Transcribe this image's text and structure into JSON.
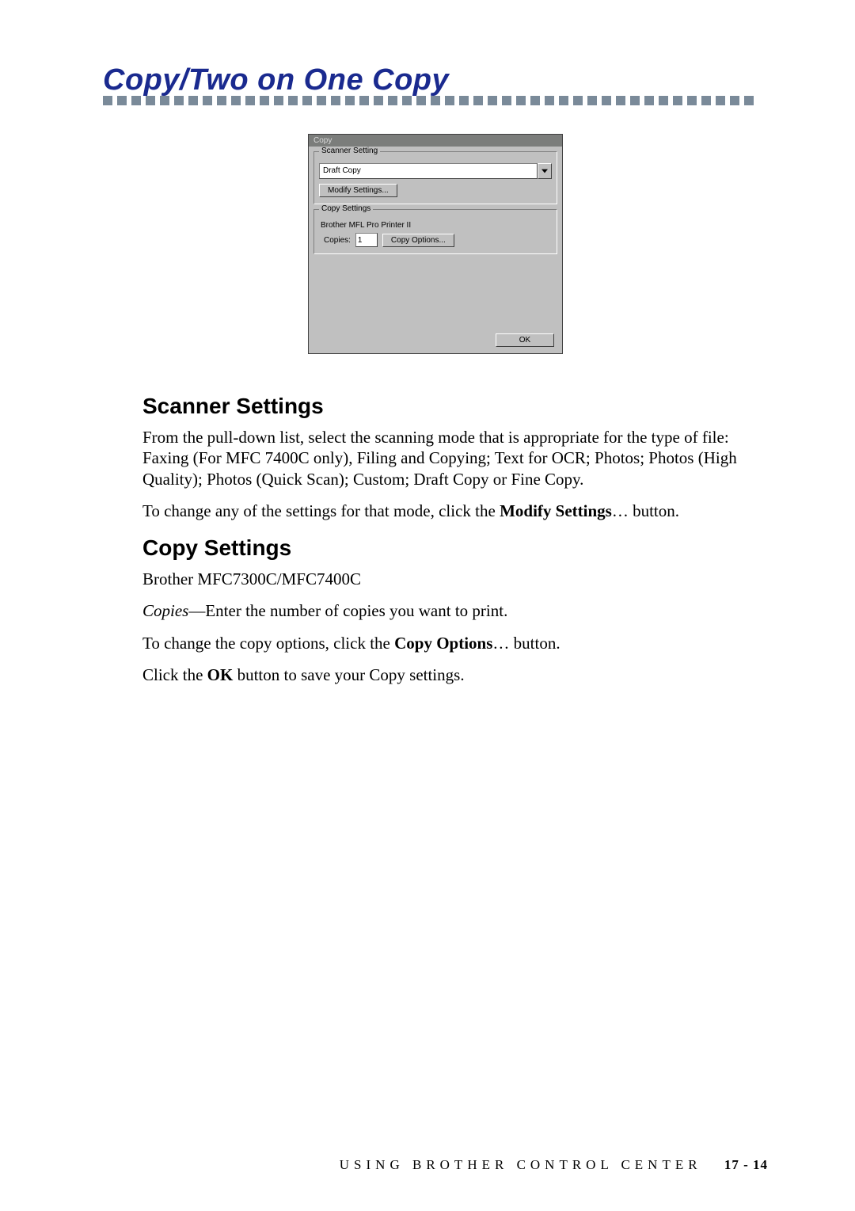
{
  "title": "Copy/Two on One Copy",
  "dialog": {
    "window_title": "Copy",
    "scanner_group": {
      "legend": "Scanner Setting",
      "selected": "Draft Copy",
      "modify_btn": "Modify Settings..."
    },
    "copy_group": {
      "legend": "Copy Settings",
      "printer": "Brother MFL Pro Printer II",
      "copies_label": "Copies:",
      "copies_value": "1",
      "copy_options_btn": "Copy Options..."
    },
    "ok_btn": "OK"
  },
  "sections": {
    "scanner": {
      "heading": "Scanner Settings",
      "p1": "From the pull-down list, select the scanning mode that is appropriate for the type of file:  Faxing (For MFC 7400C only), Filing and Copying; Text for OCR; Photos; Photos (High Quality); Photos (Quick Scan); Custom; Draft Copy or Fine Copy.",
      "p2_pre": "To change any of the settings for that mode, click the ",
      "p2_bold": "Modify Settings",
      "p2_post": "… button."
    },
    "copy": {
      "heading": "Copy Settings",
      "p1": "Brother MFC7300C/MFC7400C",
      "p2_ital": "Copies",
      "p2_rest": "—Enter the number of copies you want to print.",
      "p3_pre": "To change the copy options, click the ",
      "p3_bold": "Copy Options",
      "p3_post": "… button.",
      "p4_pre": "Click the ",
      "p4_bold": "OK",
      "p4_post": " button to save your Copy settings."
    }
  },
  "footer": {
    "text": "USING BROTHER CONTROL CENTER",
    "page": "17 - 14"
  }
}
